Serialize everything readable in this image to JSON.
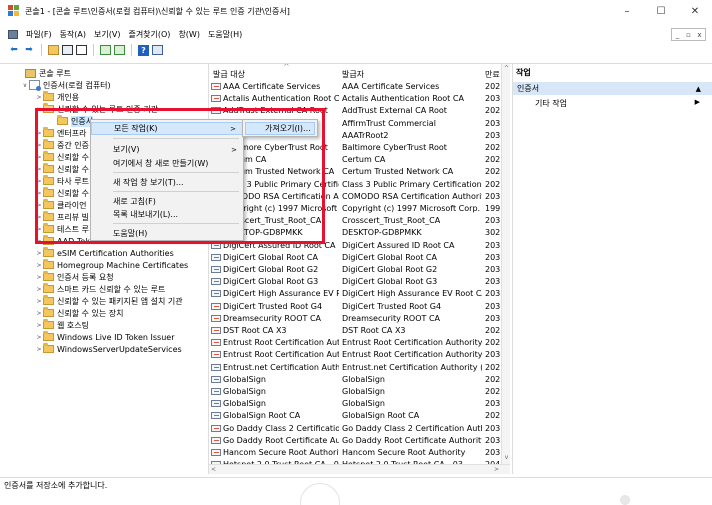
{
  "window": {
    "title": "콘솔1 - [콘솔 루트\\인증서(로컬 컴퓨터)\\신뢰할 수 있는 루트 인증 기관\\인증서]",
    "controls": [
      "–",
      "☐",
      "✕"
    ]
  },
  "menubar": {
    "items": [
      "파일(F)",
      "동작(A)",
      "보기(V)",
      "즐겨찾기(O)",
      "창(W)",
      "도움말(H)"
    ],
    "mdi_controls": [
      "_",
      "▫",
      "x"
    ]
  },
  "toolbar": {
    "buttons": [
      "back-arrow-icon",
      "forward-arrow-icon",
      "folder-up-icon",
      "show-hide-tree-icon",
      "properties-icon",
      "refresh-icon",
      "export-list-icon",
      "help-icon",
      "show-hide-action-pane-icon"
    ],
    "back": "⬅",
    "forward": "➡",
    "help": "?"
  },
  "tree": {
    "items": [
      {
        "label": "콘솔 루트",
        "level": 0,
        "expand": "",
        "icon": "console"
      },
      {
        "label": "인증서(로컬 컴퓨터)",
        "level": 1,
        "expand": "∨",
        "icon": "cert-store"
      },
      {
        "label": "개인용",
        "level": 2,
        "expand": ">",
        "icon": "folder"
      },
      {
        "label": "신뢰할 수 있는 루트 인증 기관",
        "level": 2,
        "expand": "∨",
        "icon": "folder-open"
      },
      {
        "label": "인증서",
        "level": 3,
        "expand": "",
        "icon": "folder",
        "selected": true
      },
      {
        "label": "엔터프라",
        "level": 2,
        "expand": ">",
        "icon": "folder"
      },
      {
        "label": "중간 인증",
        "level": 2,
        "expand": ">",
        "icon": "folder"
      },
      {
        "label": "신뢰할 수",
        "level": 2,
        "expand": ">",
        "icon": "folder"
      },
      {
        "label": "신뢰할 수",
        "level": 2,
        "expand": ">",
        "icon": "folder"
      },
      {
        "label": "타사 루트",
        "level": 2,
        "expand": ">",
        "icon": "folder"
      },
      {
        "label": "신뢰할 수",
        "level": 2,
        "expand": ">",
        "icon": "folder"
      },
      {
        "label": "클라이언",
        "level": 2,
        "expand": ">",
        "icon": "folder"
      },
      {
        "label": "프리뷰 빌",
        "level": 2,
        "expand": ">",
        "icon": "folder"
      },
      {
        "label": "테스트 루",
        "level": 2,
        "expand": ">",
        "icon": "folder"
      },
      {
        "label": "AAD Tok",
        "level": 2,
        "expand": ">",
        "icon": "folder"
      },
      {
        "label": "eSIM Certification Authorities",
        "level": 2,
        "expand": ">",
        "icon": "folder"
      },
      {
        "label": "Homegroup Machine Certificates",
        "level": 2,
        "expand": ">",
        "icon": "folder"
      },
      {
        "label": "인증서 등록 요청",
        "level": 2,
        "expand": ">",
        "icon": "folder"
      },
      {
        "label": "스마트 카드 신뢰할 수 있는 루트",
        "level": 2,
        "expand": ">",
        "icon": "folder"
      },
      {
        "label": "신뢰할 수 있는 패키지된 앱 설치 기관",
        "level": 2,
        "expand": ">",
        "icon": "folder"
      },
      {
        "label": "신뢰할 수 있는 장치",
        "level": 2,
        "expand": ">",
        "icon": "folder"
      },
      {
        "label": "웹 호스팅",
        "level": 2,
        "expand": ">",
        "icon": "folder"
      },
      {
        "label": "Windows Live ID Token Issuer",
        "level": 2,
        "expand": ">",
        "icon": "folder"
      },
      {
        "label": "WindowsServerUpdateServices",
        "level": 2,
        "expand": ">",
        "icon": "folder"
      }
    ]
  },
  "list": {
    "columns": [
      "발급 대상",
      "발급자",
      "만료"
    ],
    "sort_indicator": "^",
    "rows": [
      [
        "AAA Certificate Services",
        "AAA Certificate Services",
        "202"
      ],
      [
        "Actalis Authentication Root CA",
        "Actalis Authentication Root CA",
        "203"
      ],
      [
        "AddTrust External CA Root",
        "AddTrust External CA Root",
        "202"
      ],
      [
        "",
        "AffirmTrust Commercial",
        "203"
      ],
      [
        "",
        "AAATrRoot2",
        "203"
      ],
      [
        "Baltimore CyberTrust Root",
        "Baltimore CyberTrust Root",
        "202"
      ],
      [
        "Certum CA",
        "Certum CA",
        "202"
      ],
      [
        "Certum Trusted Network CA",
        "Certum Trusted Network CA",
        "202"
      ],
      [
        "Class 3 Public Primary Certific...",
        "Class 3 Public Primary Certification A...",
        "202"
      ],
      [
        "COMODO RSA Certification A...",
        "COMODO RSA Certification Authority",
        "203"
      ],
      [
        "Copyright (c) 1997 Microsoft ...",
        "Copyright (c) 1997 Microsoft Corp.",
        "199"
      ],
      [
        "Crosscert_Trust_Root_CA",
        "Crosscert_Trust_Root_CA",
        "203"
      ],
      [
        "DESKTOP-GD8PMKK",
        "DESKTOP-GD8PMKK",
        "302"
      ],
      [
        "DigiCert Assured ID Root CA",
        "DigiCert Assured ID Root CA",
        "203"
      ],
      [
        "DigiCert Global Root CA",
        "DigiCert Global Root CA",
        "203"
      ],
      [
        "DigiCert Global Root G2",
        "DigiCert Global Root G2",
        "203"
      ],
      [
        "DigiCert Global Root G3",
        "DigiCert Global Root G3",
        "203"
      ],
      [
        "DigiCert High Assurance EV R...",
        "DigiCert High Assurance EV Root CA",
        "203"
      ],
      [
        "DigiCert Trusted Root G4",
        "DigiCert Trusted Root G4",
        "203"
      ],
      [
        "Dreamsecurity ROOT CA",
        "Dreamsecurity ROOT CA",
        "203"
      ],
      [
        "DST Root CA X3",
        "DST Root CA X3",
        "202"
      ],
      [
        "Entrust Root Certification Auth...",
        "Entrust Root Certification Authority",
        "202"
      ],
      [
        "Entrust Root Certification Auth...",
        "Entrust Root Certification Authority - ...",
        "203"
      ],
      [
        "Entrust.net Certification Author...",
        "Entrust.net Certification Authority (20...",
        "202"
      ],
      [
        "GlobalSign",
        "GlobalSign",
        "202"
      ],
      [
        "GlobalSign",
        "GlobalSign",
        "202"
      ],
      [
        "GlobalSign",
        "GlobalSign",
        "203"
      ],
      [
        "GlobalSign Root CA",
        "GlobalSign Root CA",
        "202"
      ],
      [
        "Go Daddy Class 2 Certification...",
        "Go Daddy Class 2 Certification Autho...",
        "203"
      ],
      [
        "Go Daddy Root Certificate Aut...",
        "Go Daddy Root Certificate Authority - ...",
        "203"
      ],
      [
        "Hancom Secure Root Authority",
        "Hancom Secure Root Authority",
        "203"
      ],
      [
        "Hotspot 2.0 Trust Root CA - 03",
        "Hotspot 2.0 Trust Root CA - 03",
        "204"
      ]
    ]
  },
  "actions": {
    "header": "작업",
    "selected": "인증서",
    "selected_caret": "▲",
    "item": "기타 작업",
    "item_arrow": "▶"
  },
  "context_menu": {
    "items": [
      {
        "label": "모든 작업(K)",
        "arrow": ">",
        "highlight": true
      },
      {
        "label": "보기(V)",
        "arrow": ">"
      },
      {
        "label": "여기에서 창 새로 만들기(W)",
        "arrow": ""
      },
      {
        "label": "새 작업 창 보기(T)...",
        "arrow": ""
      },
      {
        "label": "새로 고침(F)",
        "arrow": ""
      },
      {
        "label": "목록 내보내기(L)...",
        "arrow": ""
      },
      {
        "label": "도움말(H)",
        "arrow": ""
      }
    ],
    "submenu_item": "가져오기(I)...",
    "highlight_color": "#d4e7fb"
  },
  "status": {
    "text": "인증서를 저장소에 추가합니다."
  },
  "scroll": {
    "up": "^",
    "down": "v",
    "left": "<",
    "right": ">"
  },
  "colors": {
    "annotation_red": "#e8112d",
    "selection_blue": "#cce8ff",
    "action_highlight": "#d7e7f7"
  }
}
